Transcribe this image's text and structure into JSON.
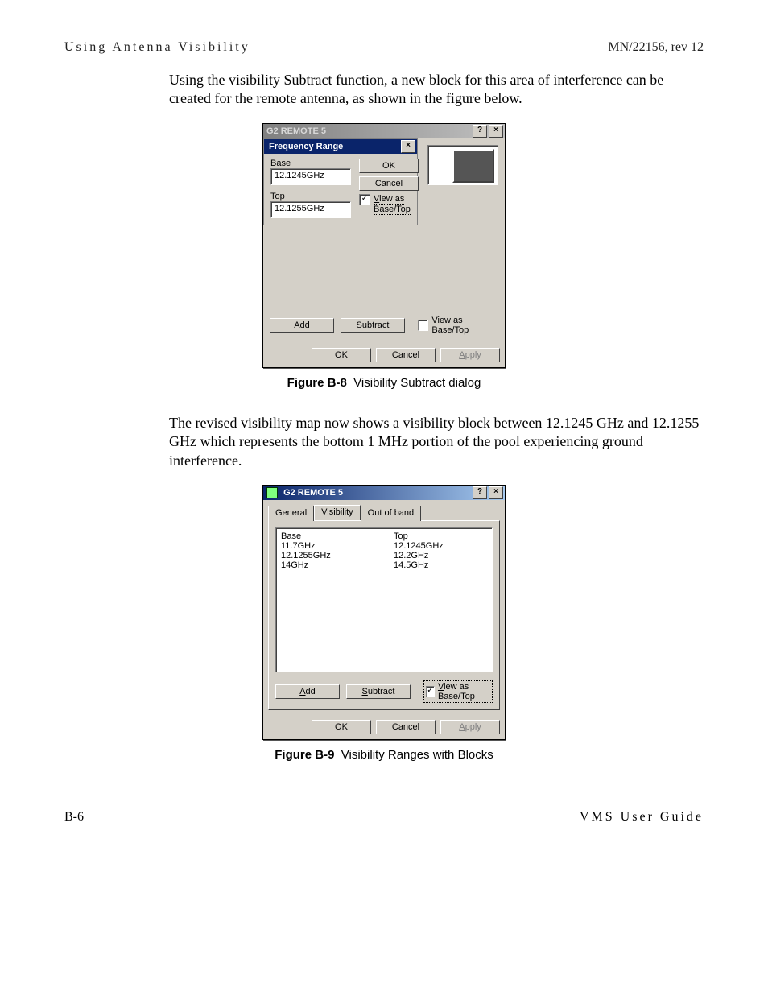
{
  "header": {
    "left": "Using Antenna Visibility",
    "right": "MN/22156, rev 12"
  },
  "para1": "Using the visibility Subtract function, a new block for this area of interference can be created for the remote antenna, as shown in the figure below.",
  "para2": "The revised visibility map now shows a visibility block between 12.1245 GHz and 12.1255 GHz which represents the bottom 1 MHz portion of the pool experiencing ground interference.",
  "footer": {
    "left": "B-6",
    "right": "VMS User Guide"
  },
  "figB8": {
    "caption_label": "Figure B-8",
    "caption_text": "Visibility Subtract dialog",
    "main_window_title": "G2 REMOTE 5",
    "help_btn": "?",
    "close_btn": "×",
    "sub_dialog": {
      "title": "Frequency Range",
      "base_label": "Base",
      "base_value": "12.1245GHz",
      "top_label_u": "T",
      "top_label_rest": "op",
      "top_value": "12.1255GHz",
      "ok": "OK",
      "cancel": "Cancel",
      "viewas_chk_u": "V",
      "viewas_chk_rest1": "iew as",
      "viewas_chk_line2_u": "B",
      "viewas_chk_line2_rest": "ase/Top",
      "checked": "✓"
    },
    "toolbar": {
      "add_u": "A",
      "add_rest": "dd",
      "sub_u": "S",
      "sub_rest": "ubtract",
      "viewas_label": "View as Base/Top",
      "ok": "OK",
      "cancel": "Cancel",
      "apply_u": "A",
      "apply_rest": "pply"
    }
  },
  "figB9": {
    "caption_label": "Figure B-9",
    "caption_text": "Visibility Ranges with Blocks",
    "title": "G2 REMOTE 5",
    "help_btn": "?",
    "close_btn": "×",
    "tabs": {
      "general": "General",
      "visibility": "Visibility",
      "outofband": "Out of band"
    },
    "list": {
      "base_header": "Base",
      "top_header": "Top",
      "rows": [
        {
          "base": "11.7GHz",
          "top": "12.1245GHz"
        },
        {
          "base": "12.1255GHz",
          "top": "12.2GHz"
        },
        {
          "base": "14GHz",
          "top": "14.5GHz"
        }
      ]
    },
    "toolbar": {
      "add_u": "A",
      "add_rest": "dd",
      "sub_u": "S",
      "sub_rest": "ubtract",
      "viewas_u": "V",
      "viewas_rest": "iew as Base/Top",
      "checked": "✓",
      "ok": "OK",
      "cancel": "Cancel",
      "apply_u": "A",
      "apply_rest": "pply"
    }
  }
}
